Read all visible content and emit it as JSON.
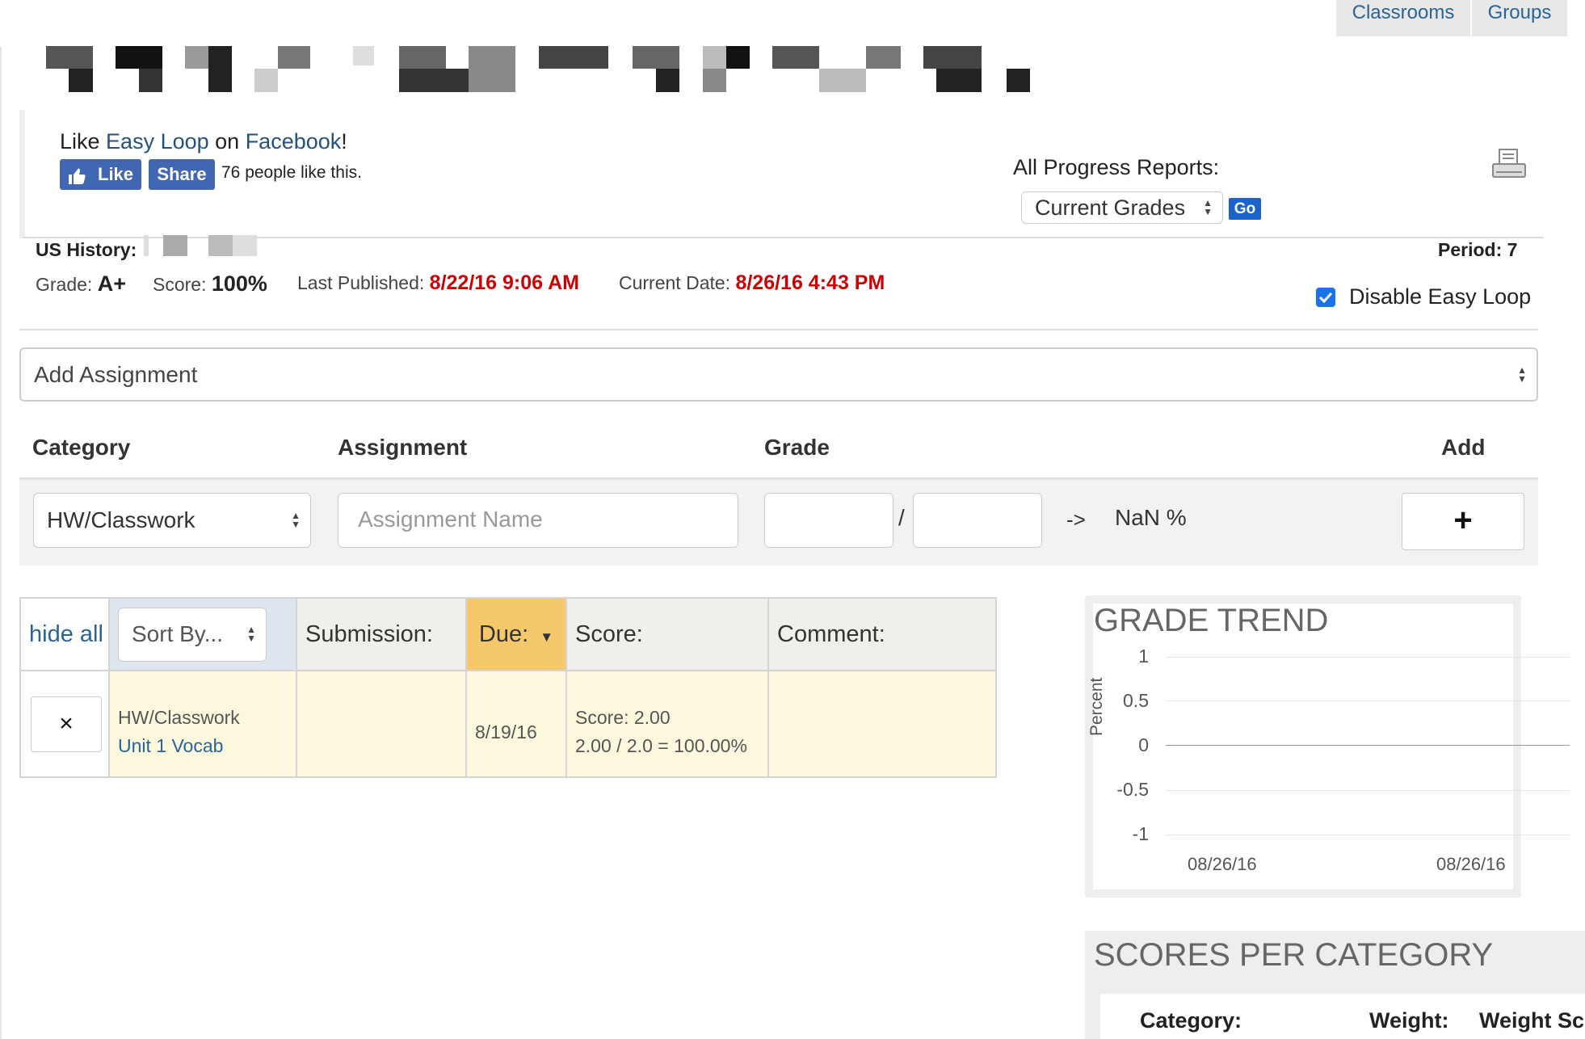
{
  "nav": {
    "classrooms": "Classrooms",
    "groups": "Groups"
  },
  "facebook": {
    "prefix": "Like ",
    "app": "Easy Loop",
    "mid": " on ",
    "site": "Facebook",
    "suffix": "!",
    "like_label": "Like",
    "share_label": "Share",
    "count_text": "76 people like this."
  },
  "progress": {
    "label": "All Progress Reports:",
    "selected": "Current Grades",
    "go_label": "Go"
  },
  "class_info": {
    "course": "US History:",
    "period": "Period: 7",
    "grade_label": "Grade:",
    "grade_value": "A+",
    "score_label": "Score:",
    "score_value": "100%",
    "published_label": "Last Published:",
    "published_value": "8/22/16 9:06 AM",
    "current_label": "Current Date:",
    "current_value": "8/26/16 4:43 PM",
    "disable_label": "Disable Easy Loop",
    "disable_checked": true
  },
  "add_assignment": {
    "selected": "Add Assignment",
    "headers": {
      "category": "Category",
      "assignment": "Assignment",
      "grade": "Grade",
      "add": "Add"
    },
    "category_selected": "HW/Classwork",
    "name_placeholder": "Assignment Name",
    "slash": "/",
    "arrow": "->",
    "result": "NaN %",
    "add_symbol": "+"
  },
  "table": {
    "hide_all": "hide all",
    "sort_by": "Sort By...",
    "headers": {
      "submission": "Submission:",
      "due": "Due:",
      "score": "Score:",
      "comment": "Comment:"
    },
    "rows": [
      {
        "remove_symbol": "×",
        "category": "HW/Classwork",
        "name": "Unit 1 Vocab",
        "submission": "",
        "due": "8/19/16",
        "score_line1": "Score: 2.00",
        "score_line2": "2.00 / 2.0 = 100.00%",
        "comment": ""
      }
    ]
  },
  "grade_trend": {
    "title": "GRADE TREND",
    "ylabel": "Percent",
    "yticks": [
      "1",
      "0.5",
      "0",
      "-0.5",
      "-1"
    ],
    "xticks": [
      "08/26/16",
      "08/26/16"
    ]
  },
  "chart_data": {
    "type": "line",
    "title": "GRADE TREND",
    "xlabel": "",
    "ylabel": "Percent",
    "x": [
      "08/26/16",
      "08/26/16"
    ],
    "series": [],
    "ylim": [
      -1,
      1
    ],
    "grid": true
  },
  "scores_per_category": {
    "title": "SCORES PER CATEGORY",
    "headers": {
      "category": "Category:",
      "weight": "Weight:",
      "weight_score": "Weight Sc"
    }
  },
  "colors": {
    "link": "#23527c",
    "alert_red": "#cc0000",
    "facebook_blue": "#4267b2",
    "go_blue": "#1a63c8",
    "due_header": "#f6c86c"
  }
}
